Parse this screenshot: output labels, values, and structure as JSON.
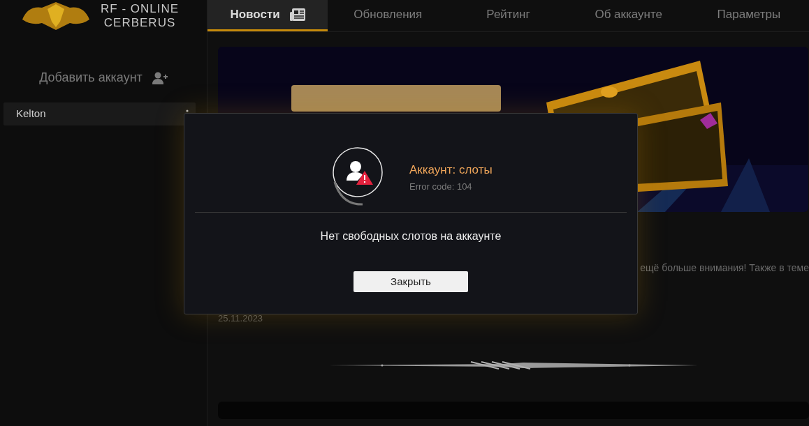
{
  "logo": {
    "line_1": "RF - ONLINE",
    "line_2": "CERBERUS"
  },
  "tabs": [
    {
      "label": "Новости",
      "selected": true
    },
    {
      "label": "Обновления",
      "selected": false
    },
    {
      "label": "Рейтинг",
      "selected": false
    },
    {
      "label": "Об аккаунте",
      "selected": false
    },
    {
      "label": "Параметры",
      "selected": false
    }
  ],
  "sidebar": {
    "add_account": "Добавить аккаунт",
    "accounts": [
      {
        "name": "Kelton",
        "selected": true
      }
    ]
  },
  "article": {
    "text_fragment": "ещё больше внимания! Также в теме",
    "date": "25.11.2023"
  },
  "dialog": {
    "title": "Аккаунт: слоты",
    "code": "Error code: 104",
    "message": "Нет свободных слотов на аккаунте",
    "button": "Закрыть"
  }
}
